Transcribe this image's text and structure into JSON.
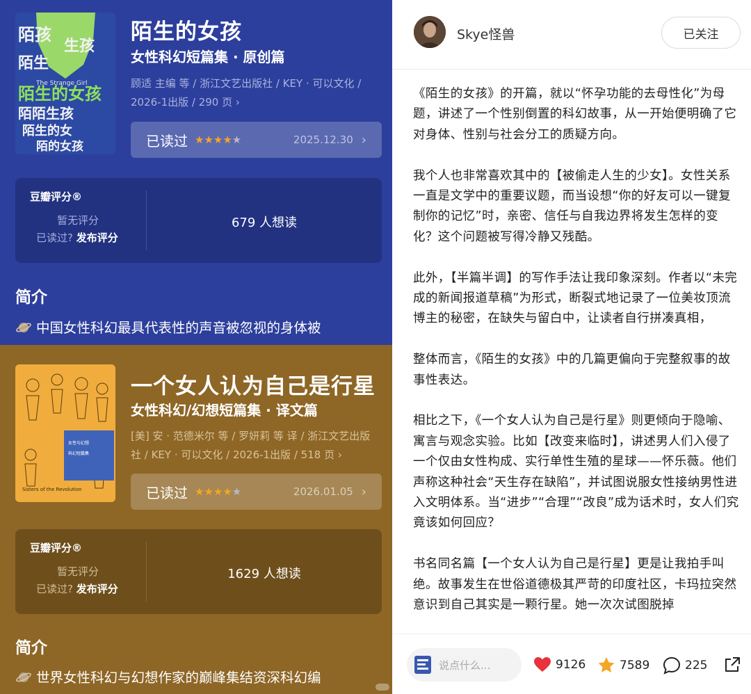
{
  "books": [
    {
      "title": "陌生的女孩",
      "subtitle": "女性科幻短篇集 · 原创篇",
      "meta_line1": "顾适 主编 等 / 浙江文艺出版社 / KEY · 可以文化 /",
      "meta_line2": "2026-1出版 / 290 页 ›",
      "read_label": "已读过",
      "stars": 4,
      "read_date": "2025.12.30",
      "rating_title": "豆瓣评分®",
      "rating_none": "暂无评分",
      "rating_question": "已读过?",
      "rating_action": "发布评分",
      "want_read": "679 人想读",
      "intro_heading": "简介",
      "intro_line1": "中国女性科幻最具代表性的声音被忽视的身体被",
      "cover_text_1": "陌生的女孩",
      "cover_text_2": "The Strange Girl"
    },
    {
      "title": "一个女人认为自己是行星",
      "subtitle": "女性科幻/幻想短篇集 · 译文篇",
      "meta_line1": "[美] 安 · 范德米尔 等 / 罗妍莉 等 译 / 浙江文艺出版",
      "meta_line2": "社 / KEY · 可以文化 / 2026-1出版 / 518 页 ›",
      "read_label": "已读过",
      "stars": 4,
      "read_date": "2026.01.05",
      "rating_title": "豆瓣评分®",
      "rating_none": "暂无评分",
      "rating_question": "已读过?",
      "rating_action": "发布评分",
      "want_read": "1629 人想读",
      "intro_heading": "简介",
      "intro_line1": "世界女性科幻与幻想作家的巅峰集结资深科幻编",
      "cover_text_1": "Sisters of the Revolution"
    }
  ],
  "author": {
    "name": "Skye怪兽",
    "follow_label": "已关注"
  },
  "review": {
    "paragraphs": [
      "《陌生的女孩》的开篇，就以“怀孕功能的去母性化”为母题，讲述了一个性别倒置的科幻故事，从一开始便明确了它对身体、性别与社会分工的质疑方向。",
      "我个人也非常喜欢其中的【被偷走人生的少女】。女性关系一直是文学中的重要议题，而当设想“你的好友可以一键复制你的记忆”时，亲密、信任与自我边界将发生怎样的变化？这个问题被写得冷静又残酷。",
      "此外，【半篇半调】的写作手法让我印象深刻。作者以“未完成的新闻报道草稿”为形式，断裂式地记录了一位美妆顶流博主的秘密，在缺失与留白中，让读者自行拼凑真相，",
      "整体而言，《陌生的女孩》中的几篇更偏向于完整叙事的故事性表达。",
      "相比之下，《一个女人认为自己是行星》则更倾向于隐喻、寓言与观念实验。比如【改变来临时】，讲述男人们入侵了一个仅由女性构成、实行单性生殖的星球——怀乐薇。他们声称这种社会“天生存在缺陷”，并试图说服女性接纳男性进入文明体系。当“进步”“合理”“改良”成为话术时，女人们究竟该如何回应？",
      "书名同名篇【一个女人认为自己是行星】更是让我拍手叫绝。故事发生在世俗道德极其严苛的印度社区，卡玛拉突然意识到自己其实是一颗行星。她一次次试图脱掉"
    ]
  },
  "bottom_bar": {
    "comment_placeholder": "说点什么...",
    "likes": "9126",
    "favorites": "7589",
    "comments": "225"
  },
  "colors": {
    "panel1_bg": "#2d3f9c",
    "panel2_bg": "#8e6626",
    "like_red": "#e8323c",
    "star_gold": "#f5a623"
  },
  "icons": [
    "planet-icon",
    "chevron-right-icon",
    "heart-icon",
    "star-icon",
    "comment-icon",
    "share-icon",
    "compose-icon"
  ]
}
